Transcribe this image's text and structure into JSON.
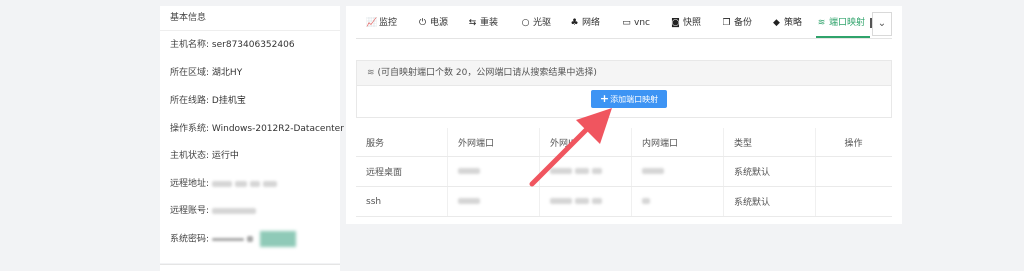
{
  "info": {
    "title": "基本信息",
    "rows": [
      {
        "label": "主机名称:",
        "value": "ser873406352406"
      },
      {
        "label": "所在区域:",
        "value": "湖北HY"
      },
      {
        "label": "所在线路:",
        "value": "D挂机宝"
      },
      {
        "label": "操作系统:",
        "value": "Windows-2012R2-Datacenter"
      },
      {
        "label": "主机状态:",
        "value": "运行中"
      },
      {
        "label": "远程地址:",
        "value": ""
      },
      {
        "label": "远程账号:",
        "value": ""
      },
      {
        "label": "系统密码:",
        "value": ""
      }
    ]
  },
  "tabs": [
    {
      "icon": "chart-icon",
      "glyph": "📈",
      "label": "监控"
    },
    {
      "icon": "power-icon",
      "glyph": "⏻",
      "label": "电源"
    },
    {
      "icon": "reinstall-icon",
      "glyph": "⇆",
      "label": "重装"
    },
    {
      "icon": "disc-icon",
      "glyph": "○",
      "label": "光驱"
    },
    {
      "icon": "network-icon",
      "glyph": "♣",
      "label": "网络"
    },
    {
      "icon": "monitor-icon",
      "glyph": "▭",
      "label": "vnc"
    },
    {
      "icon": "camera-icon",
      "glyph": "◙",
      "label": "快照"
    },
    {
      "icon": "copy-icon",
      "glyph": "❐",
      "label": "备份"
    },
    {
      "icon": "shield-icon",
      "glyph": "◆",
      "label": "策略"
    },
    {
      "icon": "wifi-icon",
      "glyph": "≋",
      "label": "端口映射",
      "active": true
    }
  ],
  "more_icon": "chevron-down-icon",
  "notice": "(可自映射端口个数 20，公网端口请从搜索结果中选择)",
  "add_button": "添加端口映射",
  "table": {
    "headers": [
      "服务",
      "外网端口",
      "外网IP",
      "内网端口",
      "类型",
      "操作"
    ],
    "rows": [
      {
        "service": "远程桌面",
        "type": "系统默认"
      },
      {
        "service": "ssh",
        "type": "系统默认"
      }
    ]
  },
  "colors": {
    "accent_green": "#2fa36b",
    "button_blue": "#3d94f4",
    "arrow_red": "#f0555f"
  }
}
